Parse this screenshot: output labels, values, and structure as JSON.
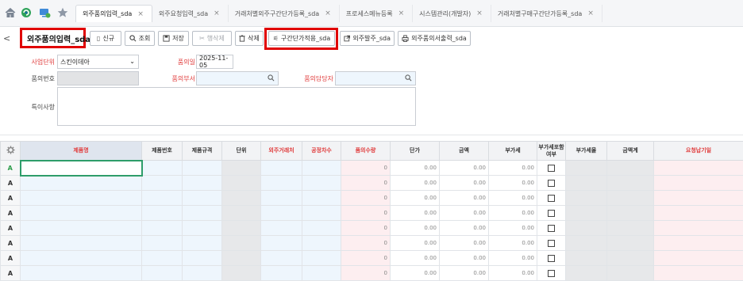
{
  "tabs": [
    {
      "label": "외주품의입력_sda",
      "active": true
    },
    {
      "label": "외주요청입력_sda",
      "active": false
    },
    {
      "label": "거래처별외주구간단가등록_sda",
      "active": false
    },
    {
      "label": "프로세스메뉴등록",
      "active": false
    },
    {
      "label": "시스템관리(개발자)",
      "active": false
    },
    {
      "label": "거래처별구매구간단가등록_sda",
      "active": false
    }
  ],
  "tab_close": "×",
  "toolbar": {
    "back": "<",
    "title": "외주품의입력_sda",
    "buttons": {
      "new": "신규",
      "search": "조회",
      "save": "저장",
      "unlock": "행삭제",
      "delete": "삭제",
      "apply_price": "구간단가적용_sda",
      "order": "외주발주_sda",
      "print": "외주품의서출력_sda"
    }
  },
  "form": {
    "business_unit_label": "사업단위",
    "business_unit_value": "스킨이데아",
    "date_label": "품의일",
    "date_value": "2025-11-05",
    "no_label": "품의번호",
    "no_value": "",
    "dept_label": "품의부서",
    "dept_value": "",
    "manager_label": "품의담당자",
    "manager_value": "",
    "remark_label": "특이사항",
    "remark_value": ""
  },
  "grid": {
    "headers": [
      {
        "label": "제품명",
        "required": true
      },
      {
        "label": "제품번호",
        "required": false
      },
      {
        "label": "제품규격",
        "required": false
      },
      {
        "label": "단위",
        "required": false
      },
      {
        "label": "외주거래처",
        "required": true
      },
      {
        "label": "공정차수",
        "required": true
      },
      {
        "label": "품의수량",
        "required": true
      },
      {
        "label": "단가",
        "required": false
      },
      {
        "label": "금액",
        "required": false
      },
      {
        "label": "부가세",
        "required": false
      },
      {
        "label": "부가세포함\n여부",
        "required": false
      },
      {
        "label": "부가세율",
        "required": false
      },
      {
        "label": "금액계",
        "required": false
      },
      {
        "label": "요청납기일",
        "required": true
      }
    ],
    "rows": [
      {
        "mark": "A",
        "qty": "0",
        "price": "0.00",
        "amount": "0.00",
        "vat": "0.00"
      },
      {
        "mark": "A",
        "qty": "0",
        "price": "0.00",
        "amount": "0.00",
        "vat": "0.00"
      },
      {
        "mark": "A",
        "qty": "0",
        "price": "0.00",
        "amount": "0.00",
        "vat": "0.00"
      },
      {
        "mark": "A",
        "qty": "0",
        "price": "0.00",
        "amount": "0.00",
        "vat": "0.00"
      },
      {
        "mark": "A",
        "qty": "0",
        "price": "0.00",
        "amount": "0.00",
        "vat": "0.00"
      },
      {
        "mark": "A",
        "qty": "0",
        "price": "0.00",
        "amount": "0.00",
        "vat": "0.00"
      },
      {
        "mark": "A",
        "qty": "0",
        "price": "0.00",
        "amount": "0.00",
        "vat": "0.00"
      },
      {
        "mark": "A",
        "qty": "0",
        "price": "0.00",
        "amount": "0.00",
        "vat": "0.00"
      }
    ]
  },
  "colors": {
    "accent": "#e00000",
    "required": "#e03c3c",
    "green": "#2e9d4c"
  }
}
